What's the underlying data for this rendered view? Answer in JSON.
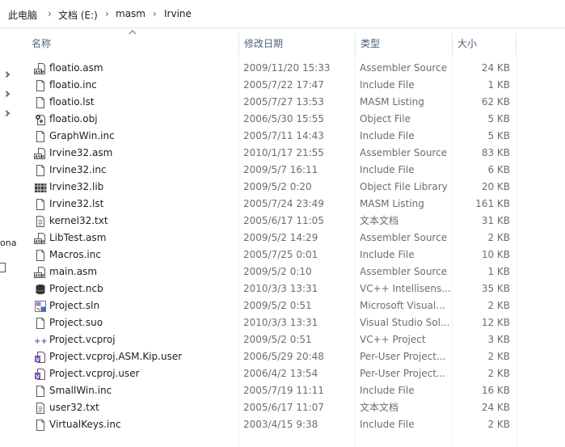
{
  "breadcrumb": {
    "items": [
      "此电脑",
      "文档 (E:)",
      "masm",
      "Irvine"
    ],
    "separator": "›"
  },
  "nav": {
    "clipped_text": "ona"
  },
  "columns": {
    "name": "名称",
    "date": "修改日期",
    "type": "类型",
    "size": "大小"
  },
  "files": [
    {
      "name": "floatio.asm",
      "date": "2009/11/20 15:33",
      "type": "Assembler Source",
      "size": "24 KB",
      "icon": "asm-file-icon"
    },
    {
      "name": "floatio.inc",
      "date": "2005/7/22 17:47",
      "type": "Include File",
      "size": "1 KB",
      "icon": "document-icon"
    },
    {
      "name": "floatio.lst",
      "date": "2005/7/27 13:53",
      "type": "MASM Listing",
      "size": "62 KB",
      "icon": "document-icon"
    },
    {
      "name": "floatio.obj",
      "date": "2006/5/30 15:55",
      "type": "Object File",
      "size": "5 KB",
      "icon": "object-file-icon"
    },
    {
      "name": "GraphWin.inc",
      "date": "2005/7/11 14:43",
      "type": "Include File",
      "size": "5 KB",
      "icon": "document-icon"
    },
    {
      "name": "Irvine32.asm",
      "date": "2010/1/17 21:55",
      "type": "Assembler Source",
      "size": "83 KB",
      "icon": "asm-file-icon"
    },
    {
      "name": "Irvine32.inc",
      "date": "2009/5/7 16:11",
      "type": "Include File",
      "size": "6 KB",
      "icon": "document-icon"
    },
    {
      "name": "Irvine32.lib",
      "date": "2009/5/2 0:20",
      "type": "Object File Library",
      "size": "20 KB",
      "icon": "library-icon"
    },
    {
      "name": "Irvine32.lst",
      "date": "2005/7/24 23:49",
      "type": "MASM Listing",
      "size": "161 KB",
      "icon": "document-icon"
    },
    {
      "name": "kernel32.txt",
      "date": "2005/6/17 11:05",
      "type": "文本文档",
      "size": "31 KB",
      "icon": "text-file-icon"
    },
    {
      "name": "LibTest.asm",
      "date": "2009/5/2 14:29",
      "type": "Assembler Source",
      "size": "2 KB",
      "icon": "asm-file-icon"
    },
    {
      "name": "Macros.inc",
      "date": "2005/7/25 0:01",
      "type": "Include File",
      "size": "10 KB",
      "icon": "document-icon"
    },
    {
      "name": "main.asm",
      "date": "2009/5/2 0:10",
      "type": "Assembler Source",
      "size": "1 KB",
      "icon": "asm-file-icon"
    },
    {
      "name": "Project.ncb",
      "date": "2010/3/3 13:31",
      "type": "VC++ Intellisens...",
      "size": "35 KB",
      "icon": "database-icon"
    },
    {
      "name": "Project.sln",
      "date": "2009/5/2 0:51",
      "type": "Microsoft Visual...",
      "size": "2 KB",
      "icon": "solution-icon"
    },
    {
      "name": "Project.suo",
      "date": "2010/3/3 13:31",
      "type": "Visual Studio Sol...",
      "size": "12 KB",
      "icon": "document-icon"
    },
    {
      "name": "Project.vcproj",
      "date": "2009/5/2 0:51",
      "type": "VC++ Project",
      "size": "3 KB",
      "icon": "cpp-project-icon"
    },
    {
      "name": "Project.vcproj.ASM.Kip.user",
      "date": "2006/5/29 20:48",
      "type": "Per-User Project...",
      "size": "2 KB",
      "icon": "user-project-icon"
    },
    {
      "name": "Project.vcproj.user",
      "date": "2006/4/2 13:54",
      "type": "Per-User Project...",
      "size": "2 KB",
      "icon": "user-project-icon"
    },
    {
      "name": "SmallWin.inc",
      "date": "2005/7/19 11:11",
      "type": "Include File",
      "size": "16 KB",
      "icon": "document-icon"
    },
    {
      "name": "user32.txt",
      "date": "2005/6/17 11:07",
      "type": "文本文档",
      "size": "24 KB",
      "icon": "text-file-icon"
    },
    {
      "name": "VirtualKeys.inc",
      "date": "2003/4/15 9:38",
      "type": "Include File",
      "size": "2 KB",
      "icon": "document-icon"
    }
  ],
  "colors": {
    "header_text": "#4c607a",
    "detail_text": "#6d6d6d",
    "name_text": "#1e1e1e"
  }
}
